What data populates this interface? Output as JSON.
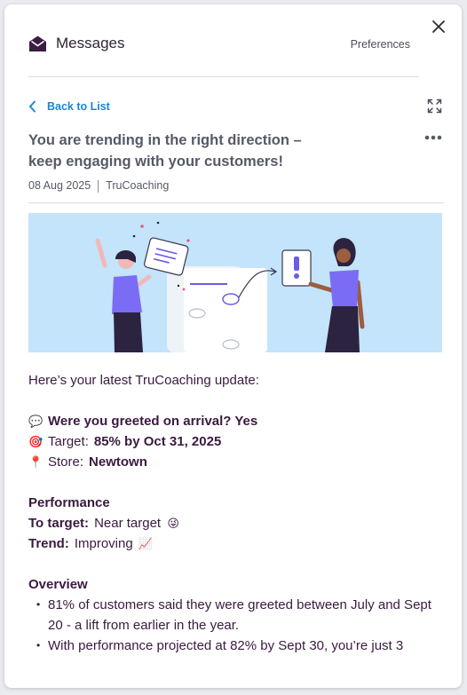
{
  "header": {
    "title": "Messages",
    "preferences_label": "Preferences",
    "icon": "envelope-open-icon",
    "close_icon": "close-icon"
  },
  "nav": {
    "back_label": "Back to List",
    "expand_icon": "expand-icon",
    "more_icon": "more-horizontal-icon"
  },
  "message": {
    "title": "You are trending in the right direction – keep engaging with your customers!",
    "date": "08 Aug 2025",
    "source": "TruCoaching",
    "intro": "Here’s your latest TruCoaching update:",
    "question_emoji": "💬",
    "question": "Were you greeted on arrival? Yes",
    "target_emoji": "🎯",
    "target_label": "Target:",
    "target_value": "85% by Oct 31, 2025",
    "store_emoji": "📍",
    "store_label": "Store:",
    "store_value": "Newtown",
    "performance_heading": "Performance",
    "to_target_label": "To target:",
    "to_target_value": "Near target",
    "to_target_emoji": "😜",
    "trend_label": "Trend:",
    "trend_value": "Improving",
    "trend_emoji": "📈",
    "overview_heading": "Overview",
    "overview_items": [
      "81% of customers said they were greeted between July and Sept 20 - a lift from earlier in the year.",
      "With performance projected at 82% by Sept 30, you’re just 3"
    ]
  },
  "colors": {
    "accent": "#1d87cf",
    "text": "#3a1a3f",
    "banner_bg": "#c3e4fb",
    "figure": "#7b6cf6"
  }
}
